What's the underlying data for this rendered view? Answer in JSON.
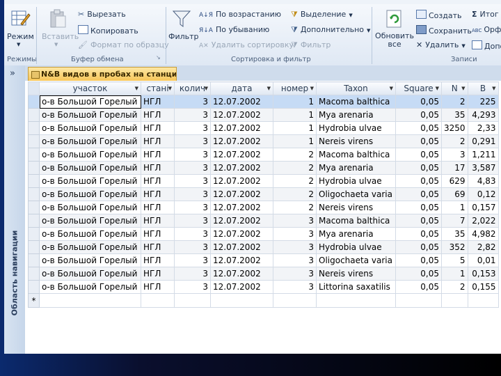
{
  "ribbon": {
    "groups": {
      "views": "Режимы",
      "clipboard": "Буфер обмена",
      "sort_filter": "Сортировка и фильтр",
      "records": "Записи"
    },
    "view_button": "Режим",
    "paste_button": "Вставить",
    "cut": "Вырезать",
    "copy": "Копировать",
    "format_painter": "Формат по образцу",
    "filter_button": "Фильтр",
    "sort_asc": "По возрастанию",
    "sort_desc": "По убыванию",
    "clear_sort": "Удалить сортировку",
    "selection": "Выделение",
    "advanced": "Дополнительно",
    "toggle_filter": "Фильтр",
    "refresh_button": "Обновить все",
    "new_record": "Создать",
    "save_record": "Сохранить",
    "delete_record": "Удалить",
    "totals": "Итог",
    "spelling": "Орф",
    "more": "Допо"
  },
  "nav": {
    "toggle": "»",
    "label": "Область навигации"
  },
  "tab": {
    "title": "N&B видов в пробах на станциях"
  },
  "table": {
    "columns": [
      "участок",
      "стані",
      "колич",
      "дата",
      "номер",
      "Taxon",
      "Square",
      "N",
      "B"
    ],
    "rows": [
      [
        "о-в Большой Горелый",
        "НГЛ",
        "3",
        "12.07.2002",
        "1",
        "Macoma balthica",
        "0,05",
        "2",
        "225"
      ],
      [
        "о-в Большой Горелый",
        "НГЛ",
        "3",
        "12.07.2002",
        "1",
        "Mya arenaria",
        "0,05",
        "35",
        "4,293"
      ],
      [
        "о-в Большой Горелый",
        "НГЛ",
        "3",
        "12.07.2002",
        "1",
        "Hydrobia ulvae",
        "0,05",
        "3250",
        "2,33"
      ],
      [
        "о-в Большой Горелый",
        "НГЛ",
        "3",
        "12.07.2002",
        "1",
        "Nereis virens",
        "0,05",
        "2",
        "0,291"
      ],
      [
        "о-в Большой Горелый",
        "НГЛ",
        "3",
        "12.07.2002",
        "2",
        "Macoma balthica",
        "0,05",
        "3",
        "1,211"
      ],
      [
        "о-в Большой Горелый",
        "НГЛ",
        "3",
        "12.07.2002",
        "2",
        "Mya arenaria",
        "0,05",
        "17",
        "3,587"
      ],
      [
        "о-в Большой Горелый",
        "НГЛ",
        "3",
        "12.07.2002",
        "2",
        "Hydrobia ulvae",
        "0,05",
        "629",
        "4,83"
      ],
      [
        "о-в Большой Горелый",
        "НГЛ",
        "3",
        "12.07.2002",
        "2",
        "Oligochaeta varia",
        "0,05",
        "69",
        "0,12"
      ],
      [
        "о-в Большой Горелый",
        "НГЛ",
        "3",
        "12.07.2002",
        "2",
        "Nereis virens",
        "0,05",
        "1",
        "0,157"
      ],
      [
        "о-в Большой Горелый",
        "НГЛ",
        "3",
        "12.07.2002",
        "3",
        "Macoma balthica",
        "0,05",
        "7",
        "2,022"
      ],
      [
        "о-в Большой Горелый",
        "НГЛ",
        "3",
        "12.07.2002",
        "3",
        "Mya arenaria",
        "0,05",
        "35",
        "4,982"
      ],
      [
        "о-в Большой Горелый",
        "НГЛ",
        "3",
        "12.07.2002",
        "3",
        "Hydrobia ulvae",
        "0,05",
        "352",
        "2,82"
      ],
      [
        "о-в Большой Горелый",
        "НГЛ",
        "3",
        "12.07.2002",
        "3",
        "Oligochaeta varia",
        "0,05",
        "5",
        "0,01"
      ],
      [
        "о-в Большой Горелый",
        "НГЛ",
        "3",
        "12.07.2002",
        "3",
        "Nereis virens",
        "0,05",
        "1",
        "0,153"
      ],
      [
        "о-в Большой Горелый",
        "НГЛ",
        "3",
        "12.07.2002",
        "3",
        "Littorina saxatilis",
        "0,05",
        "2",
        "0,155"
      ]
    ],
    "new_row_marker": "*"
  }
}
